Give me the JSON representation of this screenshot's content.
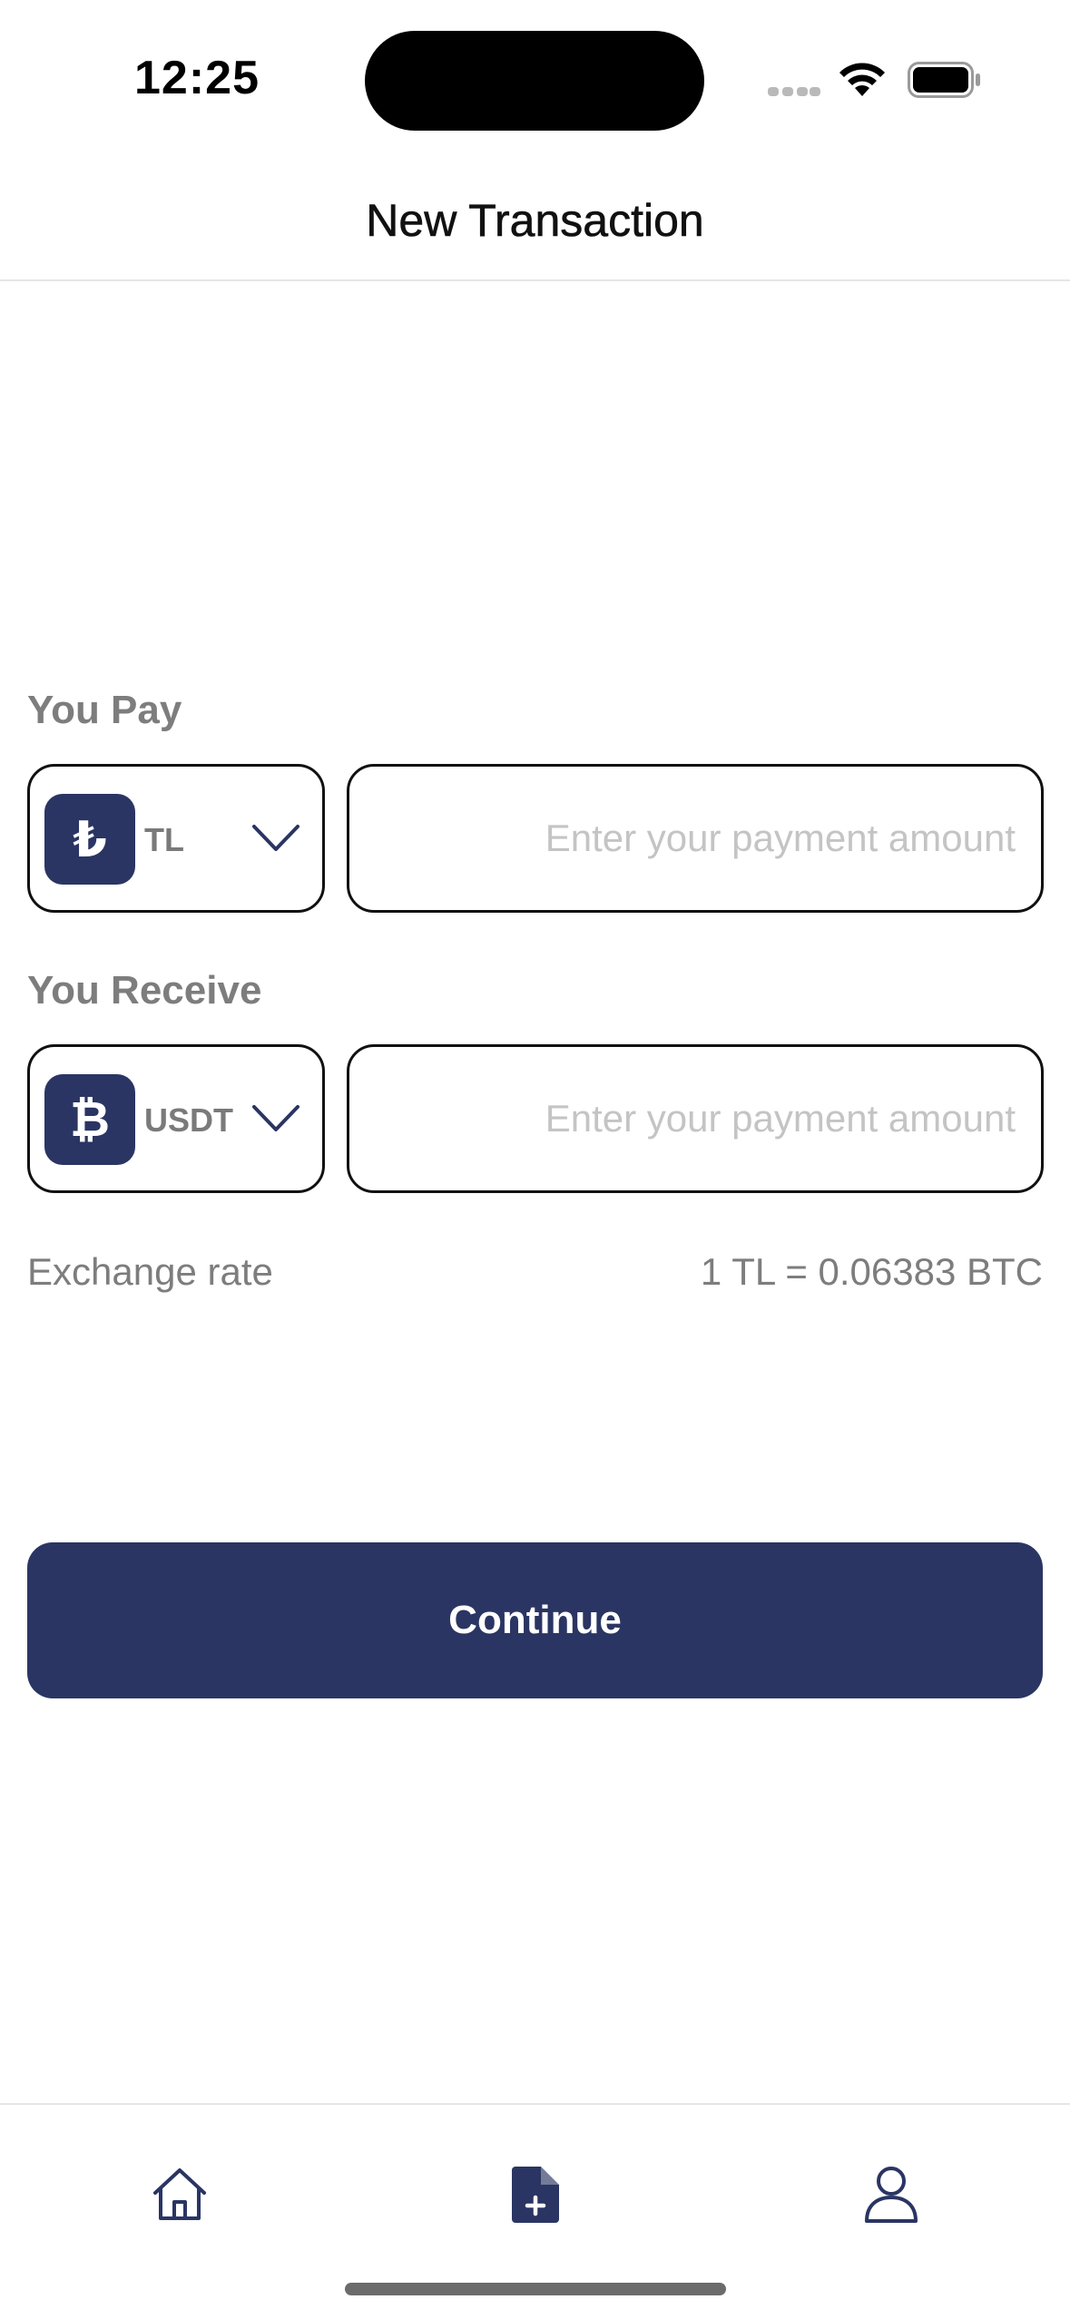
{
  "status_bar": {
    "time": "12:25"
  },
  "header": {
    "title": "New Transaction"
  },
  "pay": {
    "label": "You Pay",
    "currency_symbol": "₺",
    "currency_code": "TL",
    "amount_placeholder": "Enter your payment amount"
  },
  "receive": {
    "label": "You Receive",
    "currency_symbol": "₿",
    "currency_code": "USDT",
    "amount_placeholder": "Enter your payment amount"
  },
  "exchange": {
    "label": "Exchange rate",
    "value": "1 TL = 0.06383 BTC"
  },
  "actions": {
    "continue_label": "Continue"
  },
  "tab_bar": {
    "tabs": [
      {
        "icon": "home-icon",
        "active": false
      },
      {
        "icon": "new-document-icon",
        "active": true
      },
      {
        "icon": "profile-icon",
        "active": false
      }
    ]
  },
  "colors": {
    "primary": "#2a3563",
    "label_gray": "#7d7d7d",
    "placeholder_gray": "#c4c4c4",
    "border": "#111111"
  }
}
